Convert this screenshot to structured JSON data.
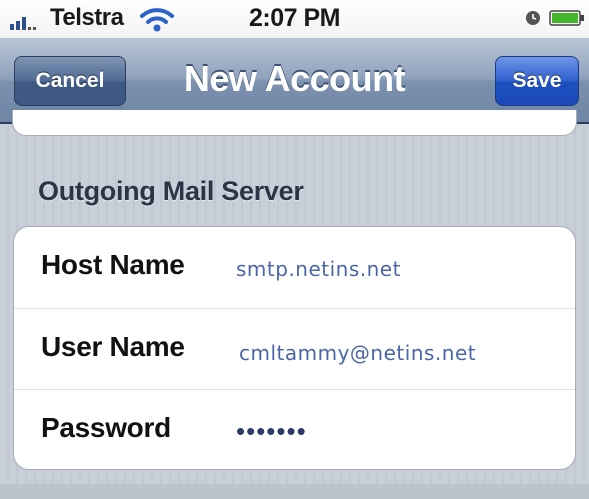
{
  "status_bar": {
    "carrier": "Telstra",
    "time": "2:07 PM",
    "icons": [
      "signal-icon",
      "wifi-icon",
      "clock-icon",
      "battery-icon"
    ]
  },
  "nav_bar": {
    "title": "New Account",
    "cancel_label": "Cancel",
    "save_label": "Save"
  },
  "section": {
    "header": "Outgoing Mail Server",
    "rows": [
      {
        "label": "Host Name",
        "value": "smtp.netins.net"
      },
      {
        "label": "User Name",
        "value": "cmltammy@netins.net"
      },
      {
        "label": "Password",
        "value": "•••••••"
      }
    ]
  },
  "colors": {
    "nav_bar": "#7c91ae",
    "save_button": "#1d4fbf",
    "value_text": "#4b66a8",
    "background": "#c5ccd6"
  }
}
